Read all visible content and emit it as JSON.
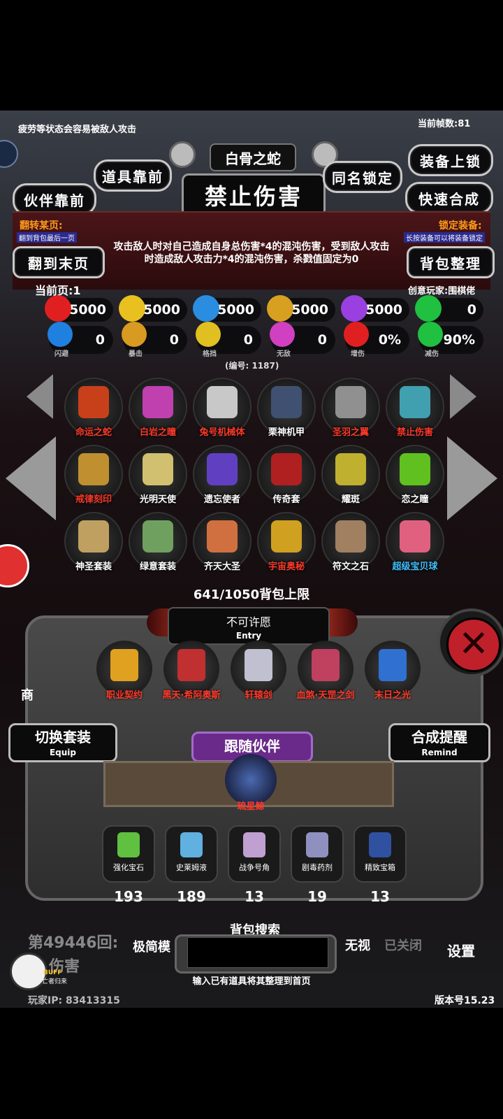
{
  "top_hint": "疲劳等状态会容易被敌人攻击",
  "fps_label": "当前帧数:81",
  "item_subtitle": "白骨之蛇",
  "item_title": "禁止伤害",
  "buttons": {
    "partner_front": "伙伴靠前",
    "item_front": "道具靠前",
    "same_name_lock": "同名锁定",
    "equip_lock": "装备上锁",
    "quick_merge": "快速合成",
    "to_last_page": "翻到末页",
    "bag_sort": "背包整理",
    "switch_set": "切换套装",
    "switch_set_sub": "Equip",
    "merge_remind": "合成提醒",
    "merge_remind_sub": "Remind",
    "follow_partner": "跟随伙伴"
  },
  "flip_page_title": "翻转某页:",
  "flip_page_sub": "翻到背包最后一页",
  "lock_equip_title": "锁定装备:",
  "lock_equip_sub": "长按装备可以将装备锁定",
  "description": "攻击敌人时对自己造成自身总伤害*4的混沌伤害，受到敌人攻击时造成敌人攻击力*4的混沌伤害，杀戮值固定为0",
  "current_page": "当前页:1",
  "creator": "创意玩家:围棋佬",
  "stats_row1": [
    {
      "icon": "heart-icon",
      "value": "5000",
      "color": "#e02020"
    },
    {
      "icon": "armor-icon",
      "value": "5000",
      "color": "#e8c020"
    },
    {
      "icon": "boot-icon",
      "value": "5000",
      "color": "#2a8de0"
    },
    {
      "icon": "sword-icon",
      "value": "5000",
      "color": "#d8a020"
    },
    {
      "icon": "lightning-icon",
      "value": "5000",
      "color": "#9a40e0"
    },
    {
      "icon": "clover-icon",
      "value": "0",
      "color": "#20c040"
    }
  ],
  "stats_row2": [
    {
      "icon": "dodge-icon",
      "value": "0",
      "label": "闪避",
      "color": "#2080e0"
    },
    {
      "icon": "crit-icon",
      "value": "0",
      "label": "暴击",
      "color": "#d89a20"
    },
    {
      "icon": "shield-icon",
      "value": "0",
      "label": "格挡",
      "color": "#e0c020"
    },
    {
      "icon": "invincible-icon",
      "value": "0",
      "label": "无敌",
      "color": "#d040c0"
    },
    {
      "icon": "damage-up-icon",
      "value": "0%",
      "label": "增伤",
      "color": "#e02020"
    },
    {
      "icon": "damage-down-icon",
      "value": "90%",
      "label": "减伤",
      "color": "#20c040"
    }
  ],
  "item_id": "(编号: 1187)",
  "bag_items": [
    {
      "name": "命运之蛇",
      "color": "#ff3a2a",
      "art": "#c8401a"
    },
    {
      "name": "白岩之瞳",
      "color": "#ff3a2a",
      "art": "#c040b0"
    },
    {
      "name": "兔号机械体",
      "color": "#ff3a2a",
      "art": "#c8c8c8"
    },
    {
      "name": "栗神机甲",
      "color": "#ffffff",
      "art": "#405070"
    },
    {
      "name": "圣羽之翼",
      "color": "#ff3a2a",
      "art": "#909090"
    },
    {
      "name": "禁止伤害",
      "color": "#ff3a2a",
      "art": "#40a0b0"
    },
    {
      "name": "戒律刻印",
      "color": "#ff3a2a",
      "art": "#c09030"
    },
    {
      "name": "光明天使",
      "color": "#ffffff",
      "art": "#d0c070"
    },
    {
      "name": "遗忘使者",
      "color": "#ffffff",
      "art": "#6040c0"
    },
    {
      "name": "传奇套",
      "color": "#ffffff",
      "art": "#b02020"
    },
    {
      "name": "耀斑",
      "color": "#ffffff",
      "art": "#c0b030"
    },
    {
      "name": "恋之瞳",
      "color": "#ffffff",
      "art": "#60c020"
    },
    {
      "name": "神圣套装",
      "color": "#ffffff",
      "art": "#c0a060"
    },
    {
      "name": "绿意套装",
      "color": "#ffffff",
      "art": "#70a060"
    },
    {
      "name": "齐天大圣",
      "color": "#ffffff",
      "art": "#d07040"
    },
    {
      "name": "宇宙奥秘",
      "color": "#ff3a2a",
      "art": "#d0a020"
    },
    {
      "name": "符文之石",
      "color": "#ffffff",
      "art": "#a08060"
    },
    {
      "name": "超级宝贝球",
      "color": "#40c0ff",
      "art": "#e06080"
    }
  ],
  "bag_limit": "641/1050背包上限",
  "entry_text": "不可许愿",
  "entry_sub": "Entry",
  "equipped": [
    {
      "name": "职业契约",
      "art": "#e0a020"
    },
    {
      "name": "黑天·希阿奥斯",
      "art": "#c03030"
    },
    {
      "name": "轩辕剑",
      "art": "#c0c0d0"
    },
    {
      "name": "血煞·天罡之剑",
      "art": "#c04060"
    },
    {
      "name": "末日之光",
      "art": "#3070d0"
    }
  ],
  "partner_name": "琉星鲸",
  "materials": [
    {
      "name": "强化宝石",
      "count": "193",
      "art": "#60c040"
    },
    {
      "name": "史莱姆液",
      "count": "189",
      "art": "#60b0e0"
    },
    {
      "name": "战争号角",
      "count": "13",
      "art": "#c0a0d0"
    },
    {
      "name": "剧毒药剂",
      "count": "19",
      "art": "#9090c0"
    },
    {
      "name": "精致宝箱",
      "count": "13",
      "art": "#3050a0"
    }
  ],
  "bg_round_text": "第49446回:",
  "bg_damage_text": "伤害",
  "bottom_left": "极简模",
  "bottom_mid": "无视",
  "bottom_closed": "已关闭",
  "settings": "设置",
  "search_title": "背包搜索",
  "search_hint": "输入已有道具将其整理到首页",
  "search_placeholder": "",
  "player_ip": "玩家IP: 83413315",
  "version": "版本号15.23",
  "buff_label": "BUFF",
  "buff_sub": "亡者归来",
  "shop_partial": "商"
}
